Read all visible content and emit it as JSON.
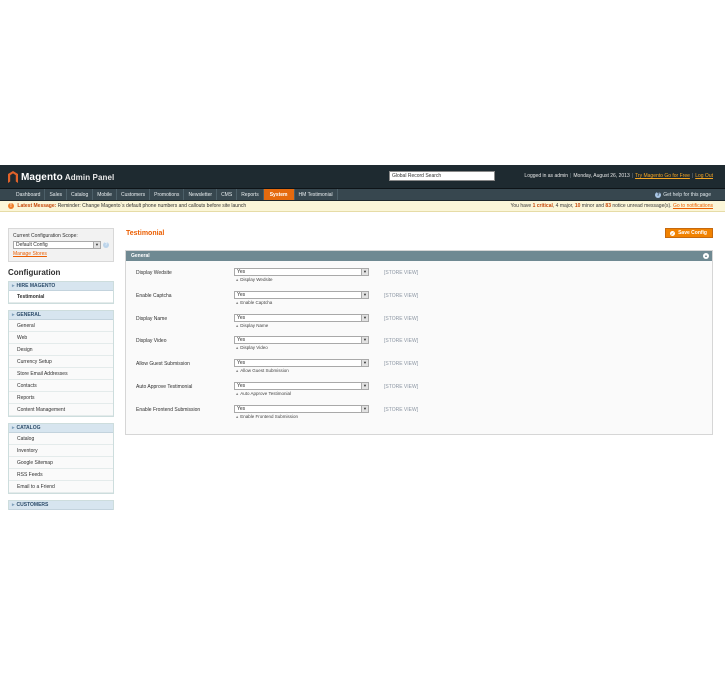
{
  "header": {
    "brand": "Magento",
    "brand_sub": "Admin Panel",
    "search_value": "Global Record Search",
    "logged_in": "Logged in as admin",
    "date": "Monday, August 26, 2013",
    "try_link": "Try Magento Go for Free",
    "logout": "Log Out"
  },
  "nav": {
    "items": [
      "Dashboard",
      "Sales",
      "Catalog",
      "Mobile",
      "Customers",
      "Promotions",
      "Newsletter",
      "CMS",
      "Reports",
      "System",
      "HM Testimonial"
    ],
    "active": "System",
    "help": "Get help for this page"
  },
  "message": {
    "label": "Latest Message:",
    "text": "Reminder: Change Magento`s default phone numbers and callouts before site launch",
    "pre": "You have",
    "critical_count": "1",
    "critical": "critical",
    "major": "4 major,",
    "minor_count": "10",
    "minor": "minor and",
    "notice_count": "83",
    "notice": "notice unread message(s).",
    "link": "Go to notifications"
  },
  "sidebar": {
    "scope_label": "Current Configuration Scope:",
    "scope_value": "Default Config",
    "manage_stores": "Manage Stores",
    "title": "Configuration",
    "sections": [
      {
        "title": "HIRE MAGENTO",
        "items": [
          "Testimonial"
        ]
      },
      {
        "title": "GENERAL",
        "items": [
          "General",
          "Web",
          "Design",
          "Currency Setup",
          "Store Email Addresses",
          "Contacts",
          "Reports",
          "Content Management"
        ]
      },
      {
        "title": "CATALOG",
        "items": [
          "Catalog",
          "Inventory",
          "Google Sitemap",
          "RSS Feeds",
          "Email to a Friend"
        ]
      },
      {
        "title": "CUSTOMERS",
        "items": []
      }
    ],
    "active_item": "Testimonial"
  },
  "main": {
    "title": "Testimonial",
    "save_label": "Save Config",
    "fieldset_title": "General",
    "scope_tag": "[STORE VIEW]",
    "rows": [
      {
        "label": "Display Wedsite",
        "value": "Yes",
        "note": "Display Wedsite"
      },
      {
        "label": "Enable Captcha",
        "value": "Yes",
        "note": "Enable Captcha"
      },
      {
        "label": "Display Name",
        "value": "Yes",
        "note": "Display Name"
      },
      {
        "label": "Display Video",
        "value": "Yes",
        "note": "Display Video"
      },
      {
        "label": "Allow Guest Submission",
        "value": "Yes",
        "note": "Allow Guest Submission"
      },
      {
        "label": "Auto Approve Testimonial",
        "value": "Yes",
        "note": "Auto Approve Testimonial"
      },
      {
        "label": "Enable Frontend Submission",
        "value": "Yes",
        "note": "Enable Frontend Submission"
      }
    ]
  },
  "colors": {
    "header_bg": "#1e2a30",
    "nav_bg": "#37474f",
    "accent": "#eb5e00",
    "section_head": "#d7e5ef",
    "fieldset_head": "#6f8992"
  }
}
